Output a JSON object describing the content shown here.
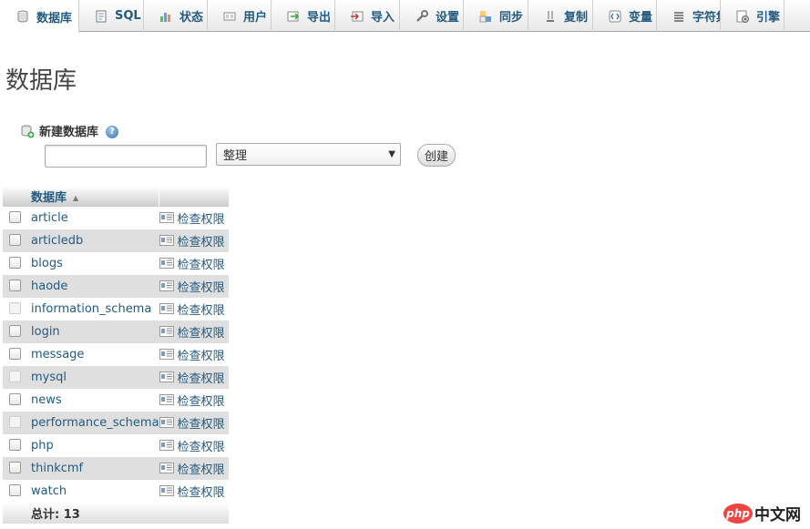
{
  "tabs": [
    {
      "label": "数据库",
      "icon": "database-icon",
      "active": true
    },
    {
      "label": "SQL",
      "icon": "sql-icon",
      "active": false
    },
    {
      "label": "状态",
      "icon": "status-icon",
      "active": false
    },
    {
      "label": "用户",
      "icon": "users-icon",
      "active": false
    },
    {
      "label": "导出",
      "icon": "export-icon",
      "active": false
    },
    {
      "label": "导入",
      "icon": "import-icon",
      "active": false
    },
    {
      "label": "设置",
      "icon": "settings-icon",
      "active": false
    },
    {
      "label": "同步",
      "icon": "sync-icon",
      "active": false
    },
    {
      "label": "复制",
      "icon": "replication-icon",
      "active": false
    },
    {
      "label": "变量",
      "icon": "variables-icon",
      "active": false
    },
    {
      "label": "字符集",
      "icon": "charset-icon",
      "active": false
    },
    {
      "label": "引擎",
      "icon": "engine-icon",
      "active": false
    }
  ],
  "page_title": "数据库",
  "create_db": {
    "label": "新建数据库",
    "help": "?",
    "name_value": "",
    "collation_selected": "整理",
    "create_label": "创建"
  },
  "table": {
    "header_name": "数据库",
    "rows": [
      {
        "name": "article",
        "priv": "检查权限",
        "disabled": false
      },
      {
        "name": "articledb",
        "priv": "检查权限",
        "disabled": false
      },
      {
        "name": "blogs",
        "priv": "检查权限",
        "disabled": false
      },
      {
        "name": "haode",
        "priv": "检查权限",
        "disabled": false
      },
      {
        "name": "information_schema",
        "priv": "检查权限",
        "disabled": true
      },
      {
        "name": "login",
        "priv": "检查权限",
        "disabled": false
      },
      {
        "name": "message",
        "priv": "检查权限",
        "disabled": false
      },
      {
        "name": "mysql",
        "priv": "检查权限",
        "disabled": true
      },
      {
        "name": "news",
        "priv": "检查权限",
        "disabled": false
      },
      {
        "name": "performance_schema",
        "priv": "检查权限",
        "disabled": true
      },
      {
        "name": "php",
        "priv": "检查权限",
        "disabled": false
      },
      {
        "name": "thinkcmf",
        "priv": "检查权限",
        "disabled": false
      },
      {
        "name": "watch",
        "priv": "检查权限",
        "disabled": false
      }
    ],
    "total_label": "总计: 13"
  },
  "watermark": {
    "logo": "php",
    "text": "中文网"
  },
  "colors": {
    "link": "#235a81",
    "row_alt": "#dfdfdf"
  }
}
